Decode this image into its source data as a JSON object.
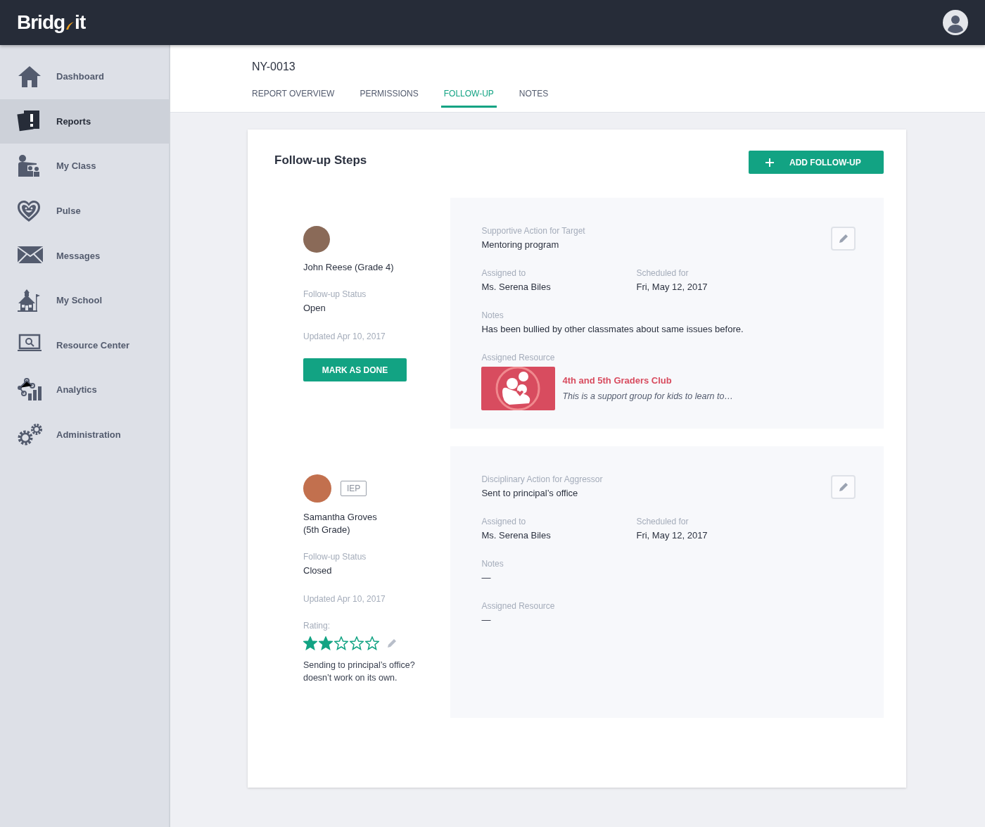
{
  "logo": {
    "left": "Bridg",
    "right": "it"
  },
  "sidebar": {
    "items": [
      {
        "label": "Dashboard",
        "selected": false
      },
      {
        "label": "Reports",
        "selected": true
      },
      {
        "label": "My Class",
        "selected": false
      },
      {
        "label": "Pulse",
        "selected": false
      },
      {
        "label": "Messages",
        "selected": false
      },
      {
        "label": "My School",
        "selected": false
      },
      {
        "label": "Resource Center",
        "selected": false
      },
      {
        "label": "Analytics",
        "selected": false
      },
      {
        "label": "Administration",
        "selected": false
      }
    ]
  },
  "header": {
    "title": "NY-0013",
    "tabs": [
      {
        "label": "REPORT OVERVIEW",
        "selected": false
      },
      {
        "label": "PERMISSIONS",
        "selected": false
      },
      {
        "label": "FOLLOW-UP",
        "selected": true
      },
      {
        "label": "NOTES",
        "selected": false
      }
    ]
  },
  "card": {
    "title": "Follow-up Steps",
    "add_button": "ADD FOLLOW-UP",
    "followups": [
      {
        "student": "John Reese (Grade 4)",
        "status_label": "Follow-up Status",
        "status": "Open",
        "updated": "Updated Apr 10, 2017",
        "action_button": "MARK AS DONE",
        "action_label": "Supportive Action for Target",
        "action": "Mentoring program",
        "assigned_label": "Assigned to",
        "assigned": "Ms. Serena Biles",
        "scheduled_label": "Scheduled for",
        "scheduled": "Fri, May 12, 2017",
        "notes_label": "Notes",
        "notes": "Has been bullied by other classmates about same issues before.",
        "resource_label": "Assigned Resource",
        "resource": {
          "title": "4th and 5th Graders Club",
          "description": "This is a support group for kids to learn to…"
        }
      },
      {
        "student": "Samantha Groves\n(5th Grade)",
        "badge": "IEP",
        "status_label": "Follow-up Status",
        "status": "Closed",
        "updated": "Updated Apr 10, 2017",
        "rating_label": "Rating:",
        "stars": 2,
        "comment": "Sending to principal’s office?\ndoesn’t work on its own.",
        "action_label": "Disciplinary Action for Aggressor",
        "action": "Sent to principal’s office",
        "assigned_label": "Assigned to",
        "assigned": "Ms. Serena Biles",
        "scheduled_label": "Scheduled for",
        "scheduled": "Fri, May 12, 2017",
        "notes_label": "Notes",
        "notes": "—",
        "resource_label": "Assigned Resource",
        "resource_none": "—"
      }
    ]
  }
}
